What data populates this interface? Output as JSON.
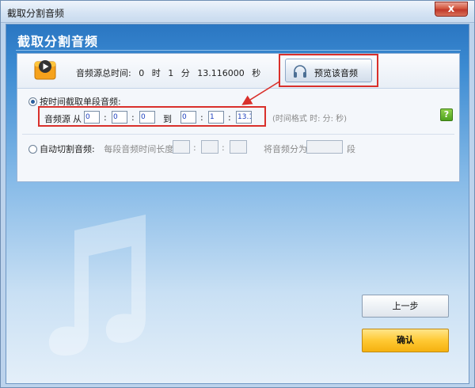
{
  "window": {
    "title": "截取分割音频",
    "close_glyph": "x"
  },
  "header": {
    "title": "截取分割音频"
  },
  "info": {
    "duration_label": "音频源总时间:",
    "hours_value": "0",
    "hours_unit": "时",
    "minutes_value": "1",
    "minutes_unit": "分",
    "seconds_value": "13.116000",
    "seconds_unit": "秒"
  },
  "preview": {
    "label": "预览该音频",
    "icon": "headphones-icon"
  },
  "mode_single": {
    "label": "按时间截取单段音频:",
    "source_label": "音频源",
    "from_label": "从",
    "to_label": "到",
    "colon": ":",
    "start": {
      "h": "0",
      "m": "0",
      "s": "0"
    },
    "end": {
      "h": "0",
      "m": "1",
      "s": "13.1"
    },
    "format_hint": "(时间格式 时: 分: 秒)"
  },
  "help": {
    "glyph": "?"
  },
  "mode_auto": {
    "label": "自动切割音频:",
    "segment_length_label": "每段音频时间长度",
    "colon": ":",
    "split_into_label": "将音频分为",
    "segments_unit": "段"
  },
  "buttons": {
    "prev_label": "上一步",
    "ok_label": "确认"
  },
  "colors": {
    "accent_red": "#d9302b",
    "ok_button": "#ffc933",
    "header_blue": "#2a76c2"
  }
}
